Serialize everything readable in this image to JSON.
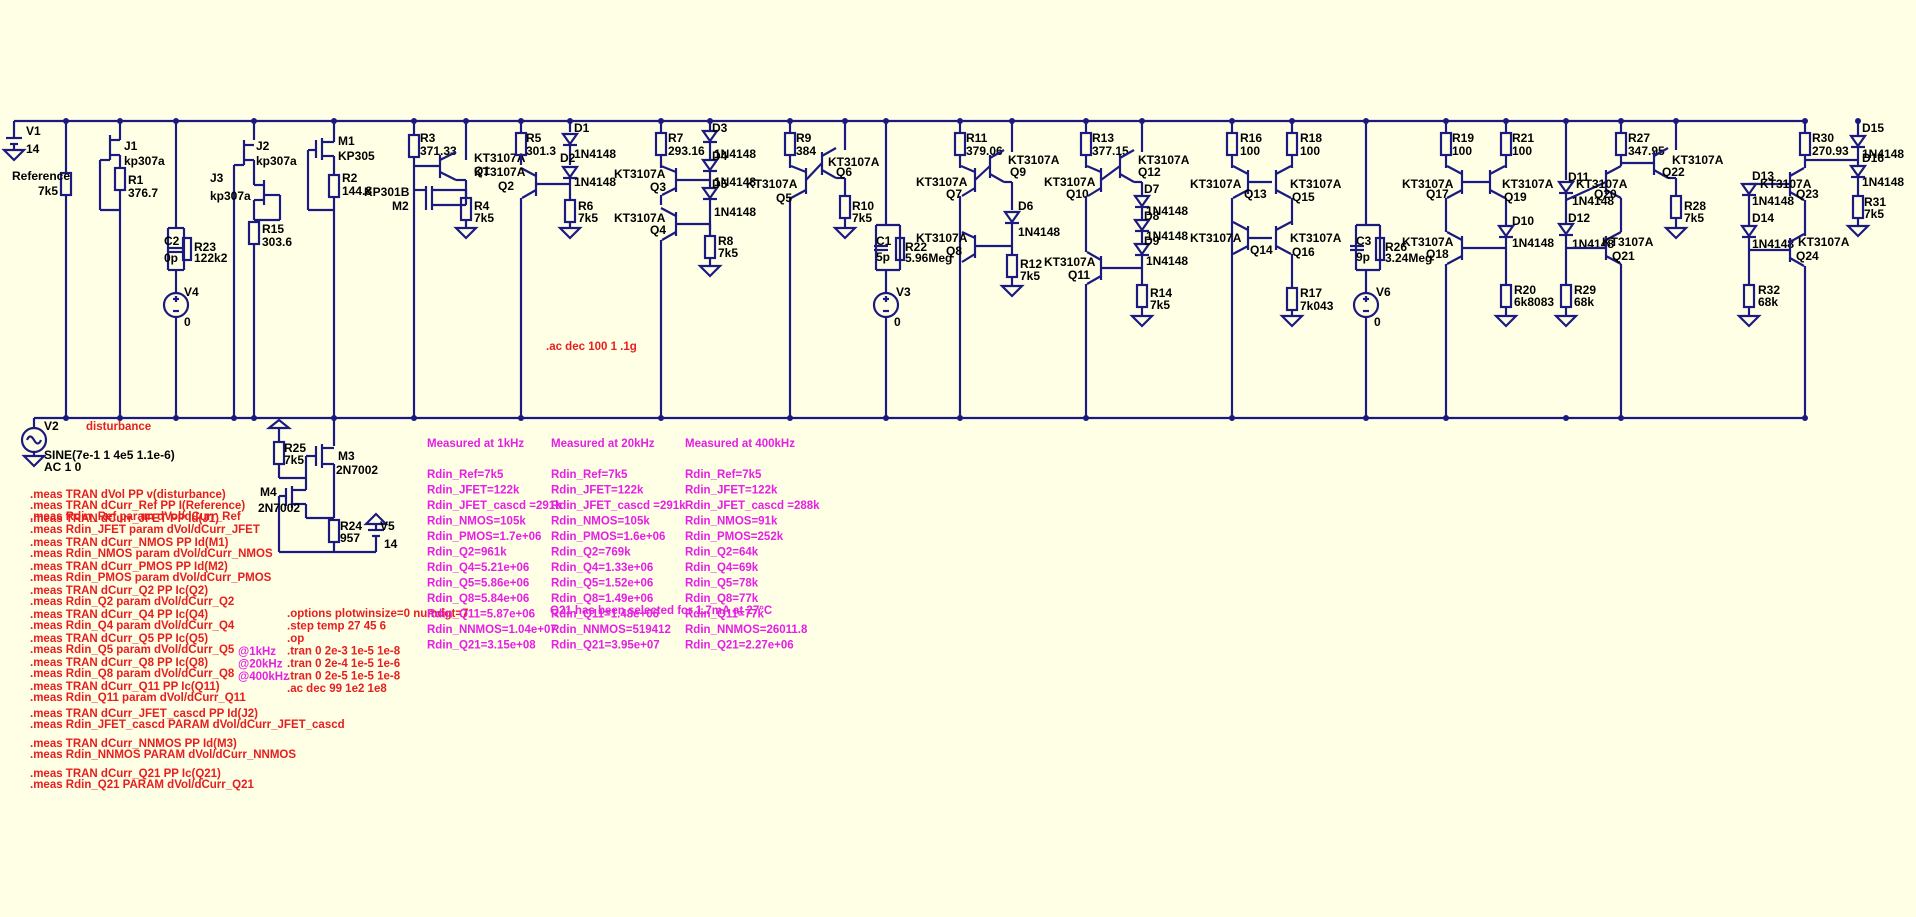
{
  "colors": {
    "background": "#ffffe6",
    "wire": "#1a1a80",
    "spice_directive": "#e61e1e",
    "comment": "#e61ee6",
    "label": "#000000"
  },
  "parts": {
    "V1": {
      "name": "V1",
      "value": "14"
    },
    "Reference": {
      "name": "Reference",
      "value": "7k5"
    },
    "J1": {
      "name": "J1",
      "value": "kp307a"
    },
    "R1": {
      "name": "R1",
      "value": "376.7"
    },
    "C2": {
      "name": "C2",
      "value": "0p"
    },
    "R23": {
      "name": "R23",
      "value": "122k2"
    },
    "V4": {
      "name": "V4",
      "value": "0"
    },
    "J2": {
      "name": "J2",
      "value": "kp307a"
    },
    "J3": {
      "name": "J3",
      "value": "kp307a"
    },
    "R15": {
      "name": "R15",
      "value": "303.6"
    },
    "M1": {
      "name": "M1",
      "value": "KP305"
    },
    "R2": {
      "name": "R2",
      "value": "144.8"
    },
    "M2": {
      "name": "M2",
      "value": "KP301B"
    },
    "R3": {
      "name": "R3",
      "value": "371.33"
    },
    "Q1": {
      "name": "Q1",
      "value": "KT3107A"
    },
    "R4": {
      "name": "R4",
      "value": "7k5"
    },
    "R5": {
      "name": "R5",
      "value": "301.3"
    },
    "D1": {
      "name": "D1",
      "value": "1N4148"
    },
    "D2": {
      "name": "D2",
      "value": "1N4148"
    },
    "Q2": {
      "name": "Q2",
      "value": "KT3107A"
    },
    "R6": {
      "name": "R6",
      "value": "7k5"
    },
    "R7": {
      "name": "R7",
      "value": "293.16"
    },
    "D3": {
      "name": "D3",
      "value": "1N4148"
    },
    "D4": {
      "name": "D4",
      "value": "1N4148"
    },
    "D5": {
      "name": "D5",
      "value": "1N4148"
    },
    "Q3": {
      "name": "Q3",
      "value": "KT3107A"
    },
    "Q4": {
      "name": "Q4",
      "value": "KT3107A"
    },
    "R8": {
      "name": "R8",
      "value": "7k5"
    },
    "R9": {
      "name": "R9",
      "value": "384"
    },
    "Q5": {
      "name": "Q5",
      "value": "KT3107A"
    },
    "Q6": {
      "name": "Q6",
      "value": "KT3107A"
    },
    "R10": {
      "name": "R10",
      "value": "7k5"
    },
    "C1": {
      "name": "C1",
      "value": "5p"
    },
    "R22": {
      "name": "R22",
      "value": "5.96Meg"
    },
    "V3": {
      "name": "V3",
      "value": "0"
    },
    "R11": {
      "name": "R11",
      "value": "379.06"
    },
    "Q7": {
      "name": "Q7",
      "value": "KT3107A"
    },
    "Q9": {
      "name": "Q9",
      "value": "KT3107A"
    },
    "D6": {
      "name": "D6",
      "value": "1N4148"
    },
    "Q8": {
      "name": "Q8",
      "value": "KT3107A"
    },
    "R12": {
      "name": "R12",
      "value": "7k5"
    },
    "R13": {
      "name": "R13",
      "value": "377.15"
    },
    "Q10": {
      "name": "Q10",
      "value": "KT3107A"
    },
    "Q12": {
      "name": "Q12",
      "value": "KT3107A"
    },
    "D7": {
      "name": "D7",
      "value": "1N4148"
    },
    "D8": {
      "name": "D8",
      "value": "1N4148"
    },
    "D9": {
      "name": "D9",
      "value": "1N4148"
    },
    "Q11": {
      "name": "Q11",
      "value": "KT3107A"
    },
    "R14": {
      "name": "R14",
      "value": "7k5"
    },
    "R16": {
      "name": "R16",
      "value": "100"
    },
    "R18": {
      "name": "R18",
      "value": "100"
    },
    "Q13": {
      "name": "Q13",
      "value": "KT3107A"
    },
    "Q15": {
      "name": "Q15",
      "value": "KT3107A"
    },
    "Q14": {
      "name": "Q14",
      "value": "KT3107A"
    },
    "Q16": {
      "name": "Q16",
      "value": "KT3107A"
    },
    "R17": {
      "name": "R17",
      "value": "7k043"
    },
    "C3": {
      "name": "C3",
      "value": "9p"
    },
    "R26": {
      "name": "R26",
      "value": "3.24Meg"
    },
    "V6": {
      "name": "V6",
      "value": "0"
    },
    "R19": {
      "name": "R19",
      "value": "100"
    },
    "R21": {
      "name": "R21",
      "value": "100"
    },
    "Q17": {
      "name": "Q17",
      "value": "KT3107A"
    },
    "Q19": {
      "name": "Q19",
      "value": "KT3107A"
    },
    "Q18": {
      "name": "Q18",
      "value": "KT3107A"
    },
    "D10": {
      "name": "D10",
      "value": "1N4148"
    },
    "R20": {
      "name": "R20",
      "value": "6k8083"
    },
    "D11": {
      "name": "D11",
      "value": "1N4148"
    },
    "D12": {
      "name": "D12",
      "value": "1N4148"
    },
    "Q20": {
      "name": "Q20",
      "value": "KT3107A"
    },
    "Q21": {
      "name": "Q21",
      "value": "KT3107A"
    },
    "R27": {
      "name": "R27",
      "value": "347.95"
    },
    "Q22": {
      "name": "Q22",
      "value": "KT3107A"
    },
    "R28": {
      "name": "R28",
      "value": "7k5"
    },
    "R29": {
      "name": "R29",
      "value": "68k"
    },
    "R30": {
      "name": "R30",
      "value": "270.93"
    },
    "D13": {
      "name": "D13",
      "value": "1N4148"
    },
    "D14": {
      "name": "D14",
      "value": "1N4148"
    },
    "Q23": {
      "name": "Q23",
      "value": "KT3107A"
    },
    "Q24": {
      "name": "Q24",
      "value": "KT3107A"
    },
    "D15": {
      "name": "D15",
      "value": "1N4148"
    },
    "D16": {
      "name": "D16",
      "value": "1N4148"
    },
    "R31": {
      "name": "R31",
      "value": "7k5"
    },
    "R32": {
      "name": "R32",
      "value": "68k"
    },
    "V2": {
      "name": "V2",
      "value": "SINE(7e-1 1 4e5 1.1e-6)",
      "ac": "AC 1 0"
    },
    "R25": {
      "name": "R25",
      "value": "7k5"
    },
    "M3": {
      "name": "M3",
      "value": "2N7002"
    },
    "M4": {
      "name": "M4",
      "value": "2N7002"
    },
    "R24": {
      "name": "R24",
      "value": "957"
    },
    "V5": {
      "name": "V5",
      "value": "14"
    }
  },
  "net_labels": {
    "disturbance": "disturbance"
  },
  "ac_directive": ".ac dec 100 1 .1g",
  "meas_directives": [
    [
      ".meas TRAN dVol PP v(disturbance)",
      ".meas TRAN dCurr_Ref PP I(Reference)",
      ".meas Rdin_Ref param dVol/dCurr_Ref"
    ],
    [
      ".meas TRAN dCurr_JFET PP Id(J1)",
      ".meas Rdin_JFET param dVol/dCurr_JFET"
    ],
    [
      ".meas TRAN dCurr_NMOS PP Id(M1)",
      ".meas Rdin_NMOS param dVol/dCurr_NMOS"
    ],
    [
      ".meas TRAN dCurr_PMOS PP Id(M2)",
      ".meas Rdin_PMOS param dVol/dCurr_PMOS"
    ],
    [
      ".meas TRAN dCurr_Q2 PP Ic(Q2)",
      ".meas Rdin_Q2 param dVol/dCurr_Q2"
    ],
    [
      ".meas TRAN dCurr_Q4 PP Ic(Q4)",
      ".meas Rdin_Q4 param dVol/dCurr_Q4"
    ],
    [
      ".meas TRAN dCurr_Q5 PP Ic(Q5)",
      ".meas Rdin_Q5 param dVol/dCurr_Q5"
    ],
    [
      ".meas TRAN dCurr_Q8 PP Ic(Q8)",
      ".meas Rdin_Q8 param dVol/dCurr_Q8"
    ],
    [
      ".meas TRAN dCurr_Q11 PP Ic(Q11)",
      ".meas Rdin_Q11 param dVol/dCurr_Q11"
    ],
    [
      ".meas TRAN dCurr_JFET_cascd PP Id(J2)",
      ".meas Rdin_JFET_cascd PARAM dVol/dCurr_JFET_cascd"
    ],
    [
      ".meas TRAN dCurr_NNMOS PP Id(M3)",
      ".meas Rdin_NNMOS PARAM dVol/dCurr_NNMOS"
    ],
    [
      ".meas TRAN dCurr_Q21 PP Ic(Q21)",
      ".meas Rdin_Q21 PARAM dVol/dCurr_Q21"
    ]
  ],
  "sim_directives": [
    ".options plotwinsize=0 numdgt=7",
    ".step temp 27 45 6",
    ".op",
    ".tran 0 2e-3 1e-5 1e-8",
    ".tran 0 2e-4 1e-5 1e-6",
    ".tran 0 2e-5 1e-5 1e-8",
    ".ac dec 99 1e2 1e8"
  ],
  "sim_freq_comments": [
    "@1kHz",
    "@20kHz",
    "@400kHz"
  ],
  "overlap_comment": "Q21 has been selected for 1.7mA at 27°C",
  "measurement_columns": [
    {
      "title": "Measured at 1kHz",
      "rows": [
        "Rdin_Ref=7k5",
        "Rdin_JFET=122k",
        "Rdin_JFET_cascd =291k",
        "Rdin_NMOS=105k",
        "Rdin_PMOS=1.7e+06",
        "Rdin_Q2=961k",
        "Rdin_Q4=5.21e+06",
        "Rdin_Q5=5.86e+06",
        "Rdin_Q8=5.84e+06",
        "Rdin_Q11=5.87e+06",
        "Rdin_NNMOS=1.04e+07",
        "Rdin_Q21=3.15e+08"
      ]
    },
    {
      "title": "Measured at 20kHz",
      "rows": [
        "Rdin_Ref=7k5",
        "Rdin_JFET=122k",
        "Rdin_JFET_cascd =291k",
        "Rdin_NMOS=105k",
        "Rdin_PMOS=1.6e+06",
        "Rdin_Q2=769k",
        "Rdin_Q4=1.33e+06",
        "Rdin_Q5=1.52e+06",
        "Rdin_Q8=1.49e+06",
        "Rdin_Q11=1.48e+06",
        "Rdin_NNMOS=519412",
        "Rdin_Q21=3.95e+07"
      ]
    },
    {
      "title": "Measured at 400kHz",
      "rows": [
        "Rdin_Ref=7k5",
        "Rdin_JFET=122k",
        "Rdin_JFET_cascd =288k",
        "Rdin_NMOS=91k",
        "Rdin_PMOS=252k",
        "Rdin_Q2=64k",
        "Rdin_Q4=69k",
        "Rdin_Q5=78k",
        "Rdin_Q8=77k",
        "Rdin_Q11=77k",
        "Rdin_NNMOS=26011.8",
        "Rdin_Q21=2.27e+06"
      ]
    }
  ]
}
